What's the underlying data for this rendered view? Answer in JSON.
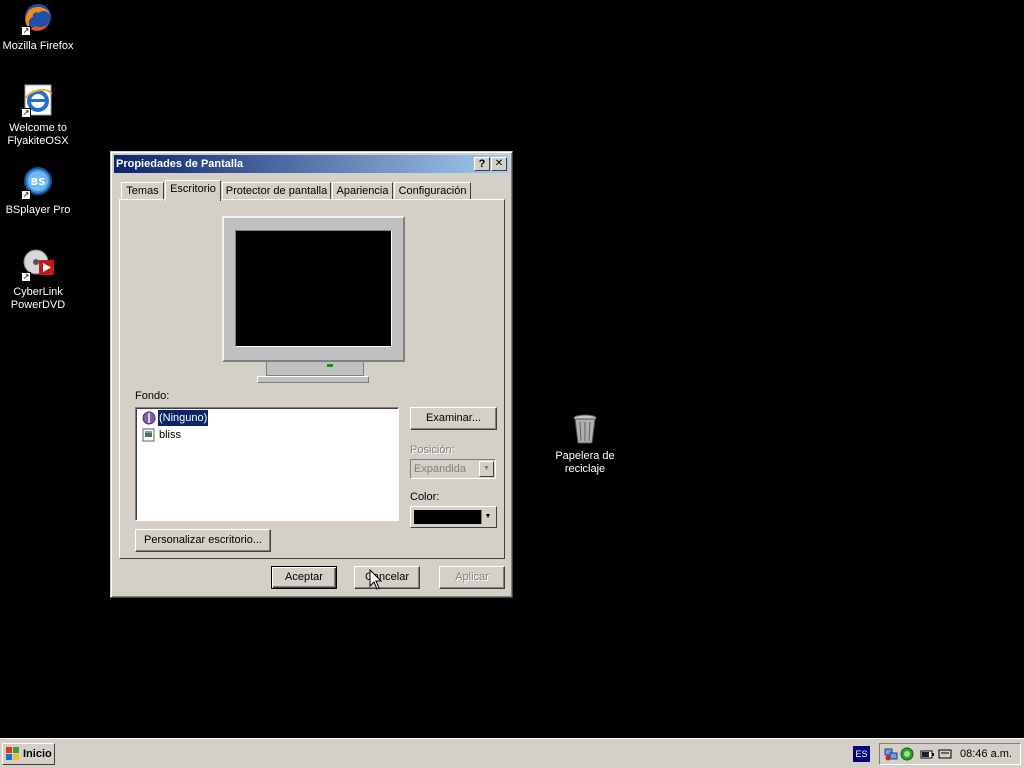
{
  "desktop": {
    "icons": [
      {
        "label": "Mozilla Firefox"
      },
      {
        "label": "Welcome to FlyakiteOSX"
      },
      {
        "label": "BSplayer Pro"
      },
      {
        "label": "CyberLink PowerDVD"
      },
      {
        "label": "Papelera de reciclaje"
      }
    ]
  },
  "dialog": {
    "title": "Propiedades de Pantalla",
    "help_glyph": "?",
    "close_glyph": "✕",
    "tabs": [
      "Temas",
      "Escritorio",
      "Protector de pantalla",
      "Apariencia",
      "Configuración"
    ],
    "active_tab": "Escritorio",
    "background_label": "Fondo:",
    "background_items": [
      "(Ninguno)",
      "bliss"
    ],
    "selected_background": "(Ninguno)",
    "browse_button": "Examinar...",
    "position_label": "Posición:",
    "position_value": "Expandida",
    "color_label": "Color:",
    "color_value": "#000000",
    "customize_button": "Personalizar escritorio...",
    "ok_button": "Aceptar",
    "cancel_button": "Cancelar",
    "apply_button": "Aplicar"
  },
  "taskbar": {
    "start_label": "Inicio",
    "language": "ES",
    "clock": "08:46 a.m."
  },
  "colors": {
    "desktop_bg": "#000000",
    "titlebar_start": "#0a246a",
    "titlebar_end": "#a6caf0",
    "face": "#d4d0c8",
    "selection": "#0a246a"
  }
}
